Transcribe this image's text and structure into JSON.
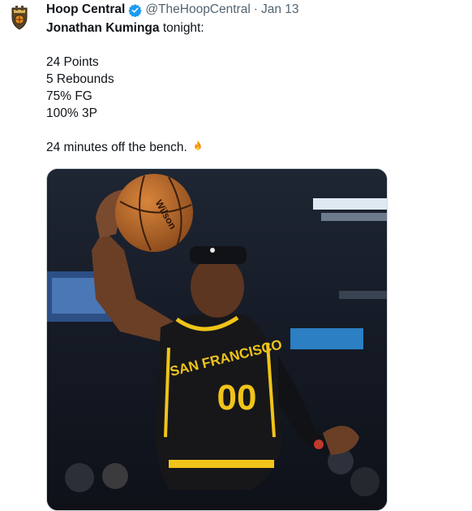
{
  "tweet": {
    "author": {
      "name": "Hoop Central",
      "handle": "@TheHoopCentral",
      "verified": true,
      "avatar_icon": "hoop-central-shield-logo"
    },
    "separator": "·",
    "date": "Jan 13",
    "text": {
      "intro_name": "Jonathan Kuminga",
      "intro_rest": " tonight:",
      "stats": [
        "24 Points",
        "5 Rebounds",
        "75% FG",
        "100% 3P"
      ],
      "closing": "24 minutes off the bench.",
      "closing_emoji": "fire-emoji"
    },
    "media": {
      "type": "photo",
      "jersey_text": "SAN FRANCISCO",
      "jersey_number": "00",
      "ball_brand": "Wilson"
    }
  },
  "colors": {
    "text": "#0f1419",
    "secondary": "#536471",
    "verified_blue": "#1d9bf0",
    "jersey_black": "#17171a",
    "jersey_gold": "#f0c419"
  }
}
